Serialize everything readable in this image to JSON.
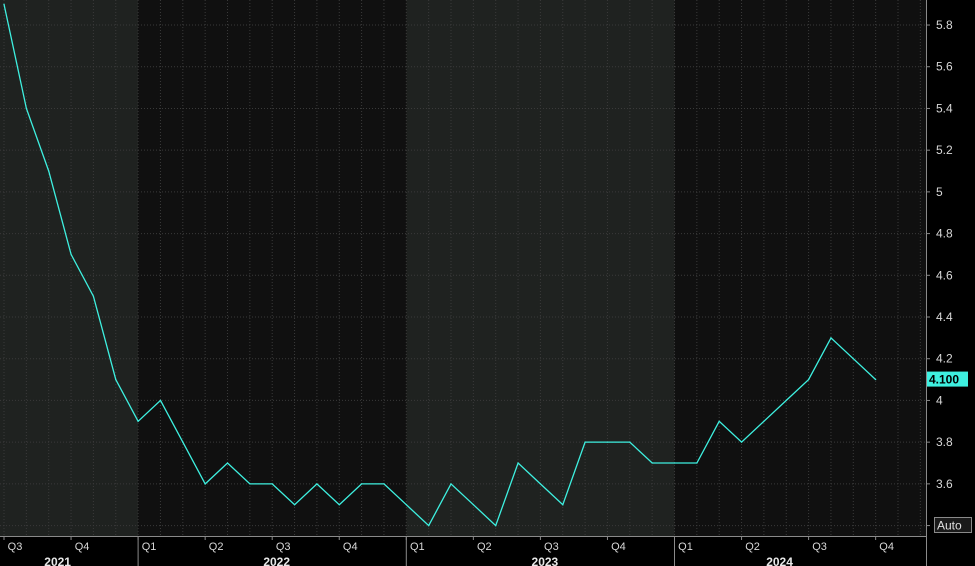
{
  "chart_data": {
    "type": "line",
    "title": "",
    "xlabel": "",
    "ylabel": "",
    "ylim": [
      3.35,
      5.92
    ],
    "y_ticks": [
      3.4,
      3.6,
      3.8,
      4,
      4.2,
      4.4,
      4.6,
      4.8,
      5,
      5.2,
      5.4,
      5.6,
      5.8
    ],
    "y_tick_labels": [
      "3.4",
      "3.6",
      "3.8",
      "4",
      "4.2",
      "4.4",
      "4.6",
      "4.8",
      "5",
      "5.2",
      "5.4",
      "5.6",
      "5.8"
    ],
    "x_quarter_labels": [
      "Q3",
      "Q4",
      "Q1",
      "Q2",
      "Q3",
      "Q4",
      "Q1",
      "Q2",
      "Q3",
      "Q4",
      "Q1",
      "Q2",
      "Q3",
      "Q4"
    ],
    "x_year_labels": [
      "2021",
      "2022",
      "2023",
      "2024"
    ],
    "x": [
      "2021-07",
      "2021-08",
      "2021-09",
      "2021-10",
      "2021-11",
      "2021-12",
      "2022-01",
      "2022-02",
      "2022-03",
      "2022-04",
      "2022-05",
      "2022-06",
      "2022-07",
      "2022-08",
      "2022-09",
      "2022-10",
      "2022-11",
      "2022-12",
      "2023-01",
      "2023-02",
      "2023-03",
      "2023-04",
      "2023-05",
      "2023-06",
      "2023-07",
      "2023-08",
      "2023-09",
      "2023-10",
      "2023-11",
      "2023-12",
      "2024-01",
      "2024-02",
      "2024-03",
      "2024-04",
      "2024-05",
      "2024-06",
      "2024-07",
      "2024-08",
      "2024-09"
    ],
    "series": [
      {
        "name": "",
        "color": "#3ef0e0",
        "values": [
          5.9,
          5.4,
          5.1,
          4.7,
          4.5,
          4.1,
          3.9,
          4.0,
          3.8,
          3.6,
          3.7,
          3.6,
          3.6,
          3.5,
          3.6,
          3.5,
          3.6,
          3.6,
          3.5,
          3.4,
          3.6,
          3.5,
          3.4,
          3.7,
          3.6,
          3.5,
          3.8,
          3.8,
          3.8,
          3.7,
          3.7,
          3.7,
          3.9,
          3.8,
          3.9,
          4.0,
          4.1,
          4.3,
          4.2,
          4.1
        ]
      }
    ],
    "last_value_label": "4.100",
    "scale_mode_label": "Auto",
    "grid": true,
    "colors": {
      "background": "#000000",
      "plot_bg_a": "#1f2220",
      "plot_bg_b": "#101010",
      "grid": "#3a3a3a",
      "line": "#3ef0e0",
      "label_bg": "#3ef0e0"
    }
  }
}
